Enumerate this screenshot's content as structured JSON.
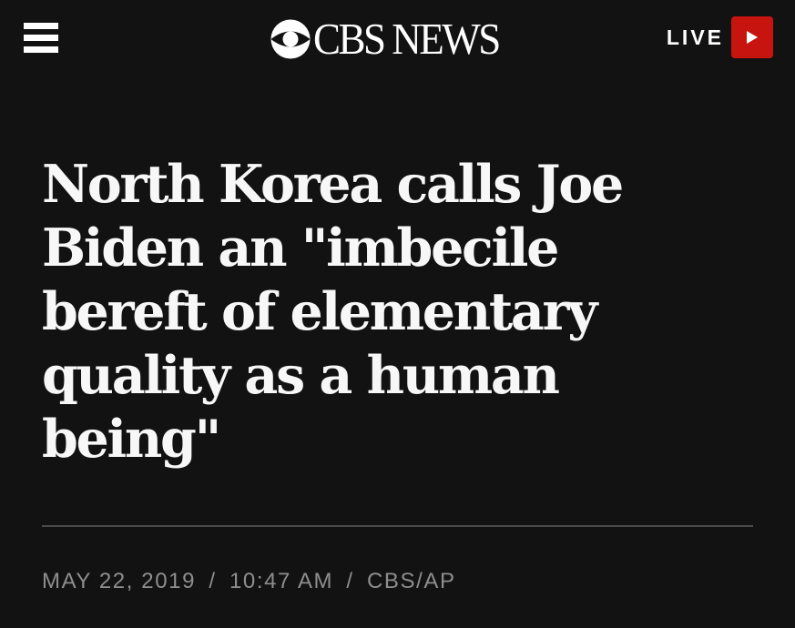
{
  "header": {
    "brand": "CBS NEWS",
    "brand_mark": "cbs-eye-icon",
    "menu_icon": "hamburger-menu-icon",
    "live_label": "LIVE",
    "live_icon": "play-icon",
    "live_color": "#c8140f",
    "background": "#121212"
  },
  "article": {
    "headline": "North Korea calls Joe Biden an \"imbecile bereft of elementary quality as a human being\"",
    "date": "MAY 22, 2019",
    "separator": "/",
    "time": "10:47 AM",
    "source": "CBS/AP"
  }
}
